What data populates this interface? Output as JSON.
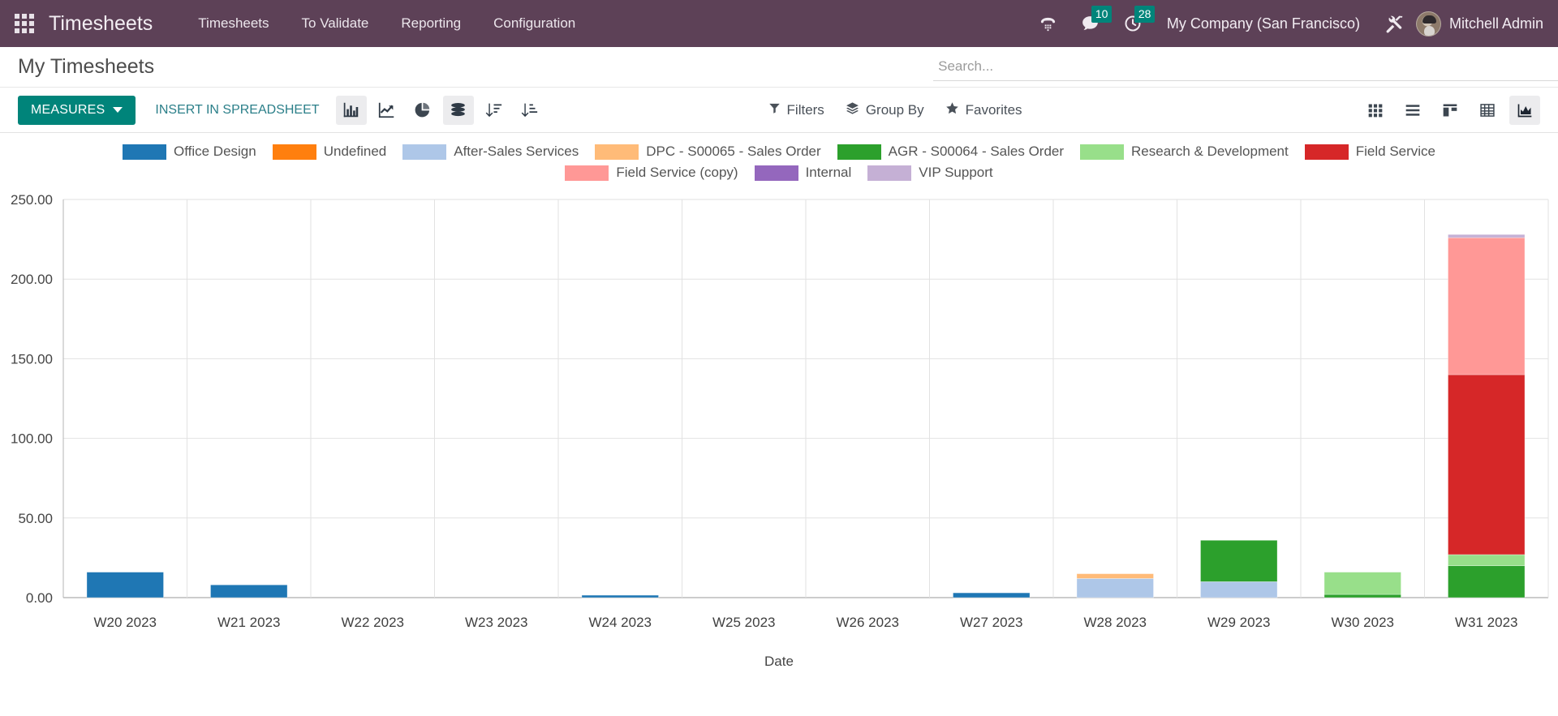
{
  "navbar": {
    "apps_icon": "apps-grid-icon",
    "brand": "Timesheets",
    "menu": [
      {
        "label": "Timesheets"
      },
      {
        "label": "To Validate"
      },
      {
        "label": "Reporting"
      },
      {
        "label": "Configuration"
      }
    ],
    "systray": {
      "phone_icon": "dialpad-phone-icon",
      "messages_icon": "chat-bubble-icon",
      "messages_count": "10",
      "activities_icon": "clock-icon",
      "activities_count": "28",
      "company": "My Company (San Francisco)",
      "tools_icon": "wrench-screwdriver-icon",
      "user": "Mitchell Admin"
    },
    "background_color": "#5D4157",
    "badge_color": "#00847A"
  },
  "control_panel": {
    "page_title": "My Timesheets",
    "search": {
      "placeholder": "Search...",
      "value": "",
      "icon": "search-icon"
    },
    "measures_label": "MEASURES",
    "insert_label": "INSERT IN SPREADSHEET",
    "chart_type_buttons": [
      {
        "name": "bar-chart-icon",
        "active": true
      },
      {
        "name": "line-chart-icon",
        "active": false
      },
      {
        "name": "pie-chart-icon",
        "active": false
      },
      {
        "name": "stacked-icon",
        "active": true
      }
    ],
    "sort_buttons": [
      {
        "name": "sort-descending-icon"
      },
      {
        "name": "sort-ascending-icon"
      }
    ],
    "filters": [
      {
        "label": "Filters",
        "icon": "funnel-icon"
      },
      {
        "label": "Group By",
        "icon": "layers-icon"
      },
      {
        "label": "Favorites",
        "icon": "star-icon"
      }
    ],
    "views": [
      {
        "name": "kanban-view-icon",
        "active": false
      },
      {
        "name": "list-view-icon",
        "active": false
      },
      {
        "name": "grid-view-icon",
        "active": false
      },
      {
        "name": "pivot-view-icon",
        "active": false
      },
      {
        "name": "graph-view-icon",
        "active": true
      }
    ],
    "accent_color": "#00847A",
    "link_color": "#2B7F89"
  },
  "chart_data": {
    "type": "bar",
    "stacked": true,
    "title": "",
    "xlabel": "Date",
    "ylabel": "",
    "ylim": [
      0,
      250
    ],
    "ytick_step": 50,
    "ytick_labels": [
      "0.00",
      "50.00",
      "100.00",
      "150.00",
      "200.00",
      "250.00"
    ],
    "grid": true,
    "legend_position": "top",
    "categories": [
      "W20 2023",
      "W21 2023",
      "W22 2023",
      "W23 2023",
      "W24 2023",
      "W25 2023",
      "W26 2023",
      "W27 2023",
      "W28 2023",
      "W29 2023",
      "W30 2023",
      "W31 2023"
    ],
    "series": [
      {
        "name": "Office Design",
        "color": "#1F77B4",
        "values": [
          16,
          8,
          0,
          0,
          1.5,
          0,
          0,
          3,
          0,
          0,
          0,
          0
        ]
      },
      {
        "name": "Undefined",
        "color": "#FF7F0E",
        "values": [
          0,
          0,
          0,
          0,
          0,
          0,
          0,
          0,
          0,
          0,
          0,
          0
        ]
      },
      {
        "name": "After-Sales Services",
        "color": "#AEC7E8",
        "values": [
          0,
          0,
          0,
          0,
          0,
          0,
          0,
          0,
          12,
          10,
          0,
          0
        ]
      },
      {
        "name": "DPC - S00065 - Sales Order",
        "color": "#FFBB78",
        "values": [
          0,
          0,
          0,
          0,
          0,
          0,
          0,
          0,
          3,
          0,
          0,
          0
        ]
      },
      {
        "name": "AGR - S00064 - Sales Order",
        "color": "#2CA02C",
        "values": [
          0,
          0,
          0,
          0,
          0,
          0,
          0,
          0,
          0,
          26,
          2,
          20
        ]
      },
      {
        "name": "Research & Development",
        "color": "#98DF8A",
        "values": [
          0,
          0,
          0,
          0,
          0,
          0,
          0,
          0,
          0,
          0,
          14,
          7
        ]
      },
      {
        "name": "Field Service",
        "color": "#D62728",
        "values": [
          0,
          0,
          0,
          0,
          0,
          0,
          0,
          0,
          0,
          0,
          0,
          113
        ]
      },
      {
        "name": "Field Service (copy)",
        "color": "#FF9896",
        "values": [
          0,
          0,
          0,
          0,
          0,
          0,
          0,
          0,
          0,
          0,
          0,
          86
        ]
      },
      {
        "name": "Internal",
        "color": "#9467BD",
        "values": [
          0,
          0,
          0,
          0,
          0,
          0,
          0,
          0,
          0,
          0,
          0,
          0
        ]
      },
      {
        "name": "VIP Support",
        "color": "#C5B0D5",
        "values": [
          0,
          0,
          0,
          0,
          0,
          0,
          0,
          0,
          0,
          0,
          0,
          2
        ]
      }
    ]
  }
}
